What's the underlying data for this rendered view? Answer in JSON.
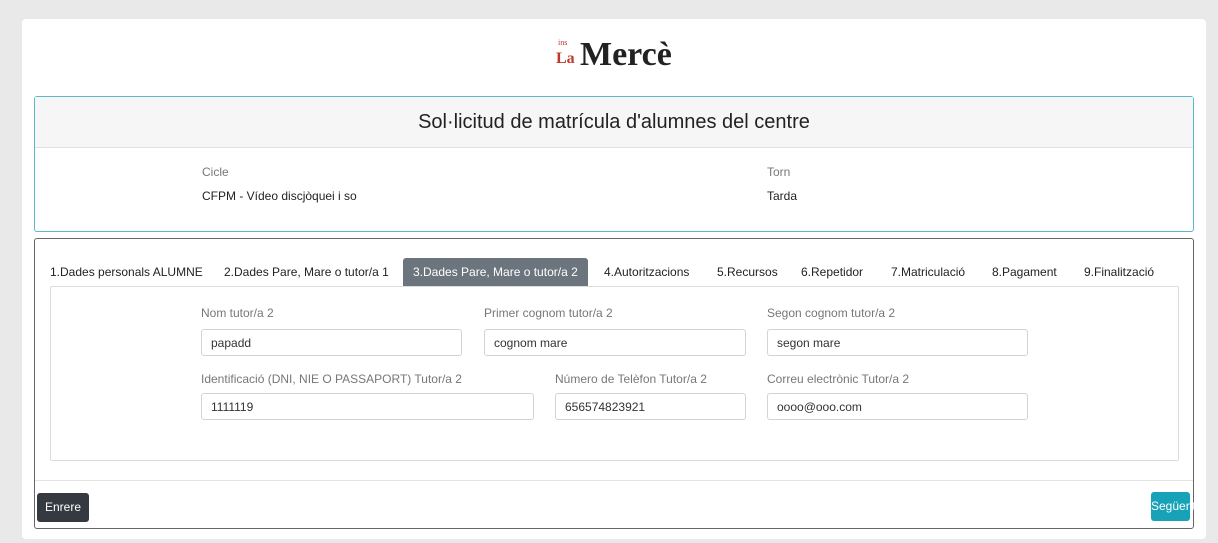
{
  "logo": {
    "small_ins": "ins",
    "small_la": "La",
    "main_text": "Mercè"
  },
  "header": {
    "title": "Sol·licitud de matrícula d'alumnes del centre"
  },
  "info": {
    "cicle_label": "Cicle",
    "cicle_value": "CFPM - Vídeo discjòquei i so",
    "torn_label": "Torn",
    "torn_value": "Tarda"
  },
  "tabs": [
    {
      "label": "1.Dades personals ALUMNE"
    },
    {
      "label": "2.Dades Pare, Mare o tutor/a 1"
    },
    {
      "label": "3.Dades Pare, Mare o tutor/a 2"
    },
    {
      "label": "4.Autoritzacions"
    },
    {
      "label": "5.Recursos"
    },
    {
      "label": "6.Repetidor"
    },
    {
      "label": "7.Matriculació"
    },
    {
      "label": "8.Pagament"
    },
    {
      "label": "9.Finalització"
    }
  ],
  "active_tab": "3.Dades Pare, Mare o tutor/a 2",
  "form": {
    "nom": {
      "label": "Nom tutor/a 2",
      "value": "papadd"
    },
    "cognom1": {
      "label": "Primer cognom tutor/a 2",
      "value": "cognom mare"
    },
    "cognom2": {
      "label": "Segon cognom tutor/a 2",
      "value": "segon mare"
    },
    "ident": {
      "label": "Identificació (DNI, NIE O PASSAPORT) Tutor/a 2",
      "value": "1111119"
    },
    "telefon": {
      "label": "Número de Telèfon Tutor/a 2",
      "value": "656574823921"
    },
    "correu": {
      "label": "Correu electrònic Tutor/a 2",
      "value": "oooo@ooo.com"
    }
  },
  "buttons": {
    "back": "Enrere",
    "next": "Següent"
  },
  "colors": {
    "accent": "#17a2b8",
    "dark": "#343a40",
    "active_tab": "#6c757d",
    "logo_red": "#c0392b"
  }
}
